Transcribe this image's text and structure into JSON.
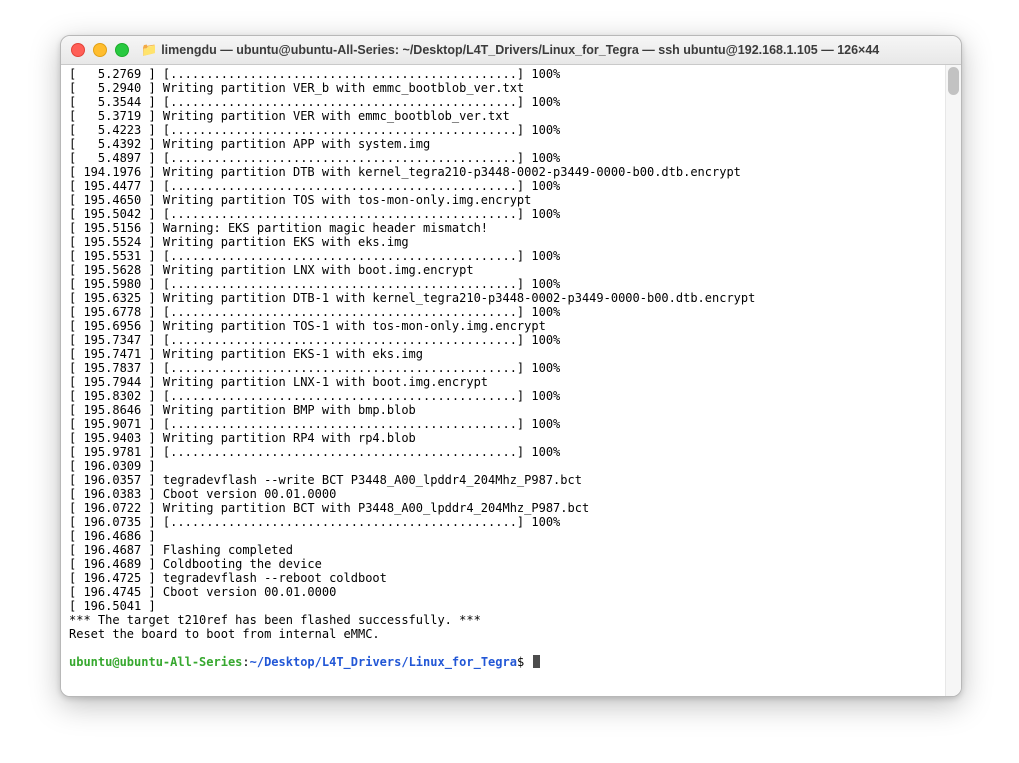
{
  "window": {
    "title": "limengdu — ubuntu@ubuntu-All-Series: ~/Desktop/L4T_Drivers/Linux_for_Tegra — ssh ubuntu@192.168.1.105 — 126×44"
  },
  "lines": [
    "[   5.2769 ] [................................................] 100%",
    "[   5.2940 ] Writing partition VER_b with emmc_bootblob_ver.txt",
    "[   5.3544 ] [................................................] 100%",
    "[   5.3719 ] Writing partition VER with emmc_bootblob_ver.txt",
    "[   5.4223 ] [................................................] 100%",
    "[   5.4392 ] Writing partition APP with system.img",
    "[   5.4897 ] [................................................] 100%",
    "[ 194.1976 ] Writing partition DTB with kernel_tegra210-p3448-0002-p3449-0000-b00.dtb.encrypt",
    "[ 195.4477 ] [................................................] 100%",
    "[ 195.4650 ] Writing partition TOS with tos-mon-only.img.encrypt",
    "[ 195.5042 ] [................................................] 100%",
    "[ 195.5156 ] Warning: EKS partition magic header mismatch!",
    "[ 195.5524 ] Writing partition EKS with eks.img",
    "[ 195.5531 ] [................................................] 100%",
    "[ 195.5628 ] Writing partition LNX with boot.img.encrypt",
    "[ 195.5980 ] [................................................] 100%",
    "[ 195.6325 ] Writing partition DTB-1 with kernel_tegra210-p3448-0002-p3449-0000-b00.dtb.encrypt",
    "[ 195.6778 ] [................................................] 100%",
    "[ 195.6956 ] Writing partition TOS-1 with tos-mon-only.img.encrypt",
    "[ 195.7347 ] [................................................] 100%",
    "[ 195.7471 ] Writing partition EKS-1 with eks.img",
    "[ 195.7837 ] [................................................] 100%",
    "[ 195.7944 ] Writing partition LNX-1 with boot.img.encrypt",
    "[ 195.8302 ] [................................................] 100%",
    "[ 195.8646 ] Writing partition BMP with bmp.blob",
    "[ 195.9071 ] [................................................] 100%",
    "[ 195.9403 ] Writing partition RP4 with rp4.blob",
    "[ 195.9781 ] [................................................] 100%",
    "[ 196.0309 ]",
    "[ 196.0357 ] tegradevflash --write BCT P3448_A00_lpddr4_204Mhz_P987.bct",
    "[ 196.0383 ] Cboot version 00.01.0000",
    "[ 196.0722 ] Writing partition BCT with P3448_A00_lpddr4_204Mhz_P987.bct",
    "[ 196.0735 ] [................................................] 100%",
    "[ 196.4686 ]",
    "[ 196.4687 ] Flashing completed",
    "",
    "[ 196.4689 ] Coldbooting the device",
    "[ 196.4725 ] tegradevflash --reboot coldboot",
    "[ 196.4745 ] Cboot version 00.01.0000",
    "[ 196.5041 ]",
    "*** The target t210ref has been flashed successfully. ***",
    "Reset the board to boot from internal eMMC."
  ],
  "prompt": {
    "user_host": "ubuntu@ubuntu-All-Series",
    "colon": ":",
    "path": "~/Desktop/L4T_Drivers/Linux_for_Tegra",
    "dollar": "$"
  }
}
